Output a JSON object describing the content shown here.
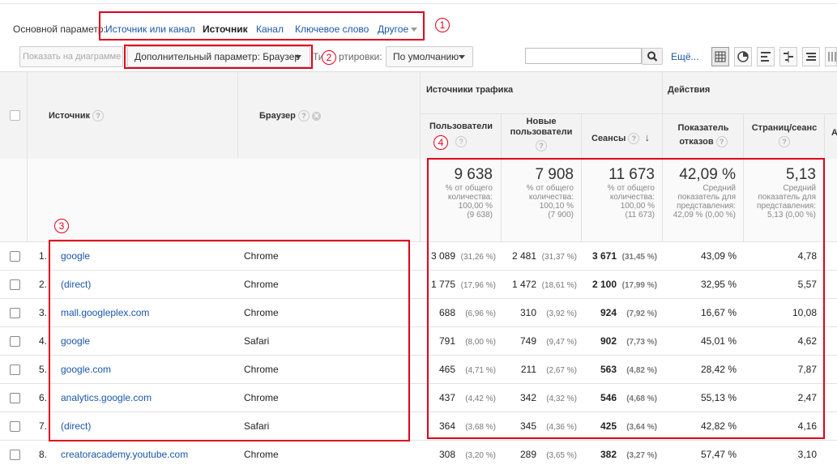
{
  "primary_dim": {
    "label": "Основной параметр:",
    "items": [
      "Источник или канал",
      "Источник",
      "Канал",
      "Ключевое слово",
      "Другое"
    ],
    "active_index": 1
  },
  "toolbar": {
    "plot_rows": "Показать на диаграмме",
    "secondary_dim": "Дополнительный параметр: Браузер",
    "sort_label_visible": "Ти",
    "sort_label_tail": "ртировки:",
    "sort_value": "По умолчанию",
    "search_placeholder": "",
    "more_link": "Ещё..."
  },
  "badges": [
    "1",
    "2",
    "3",
    "4"
  ],
  "columns": {
    "source": "Источник",
    "browser": "Браузер",
    "group_traffic": "Источники трафика",
    "group_actions": "Действия",
    "users": "Пользователи",
    "new_users_1": "Новые",
    "new_users_2": "пользователи",
    "sessions": "Сеансы",
    "bounce_1": "Показатель",
    "bounce_2": "отказов",
    "pages": "Страниц/сеанс",
    "next_partial": "А"
  },
  "totals": {
    "users": {
      "big": "9 638",
      "l1": "% от общего",
      "l2": "количества:",
      "l3": "100,00 %",
      "l4": "(9 638)"
    },
    "new_users": {
      "big": "7 908",
      "l1": "% от общего",
      "l2": "количества:",
      "l3": "100,10 %",
      "l4": "(7 900)"
    },
    "sessions": {
      "big": "11 673",
      "l1": "% от общего",
      "l2": "количества:",
      "l3": "100,00 %",
      "l4": "(11 673)"
    },
    "bounce": {
      "big": "42,09 %",
      "l1": "Средний",
      "l2": "показатель для",
      "l3": "представления:",
      "l4": "42,09 % (0,00 %)"
    },
    "pages": {
      "big": "5,13",
      "l1": "Средний",
      "l2": "показатель для",
      "l3": "представления:",
      "l4": "5,13 (0,00 %)"
    }
  },
  "rows": [
    {
      "idx": "1.",
      "source": "google",
      "browser": "Chrome",
      "users": "3 089",
      "users_pct": "(31,26 %)",
      "new": "2 481",
      "new_pct": "(31,37 %)",
      "sess": "3 671",
      "sess_pct": "(31,45 %)",
      "bounce": "43,09 %",
      "pages": "4,78"
    },
    {
      "idx": "2.",
      "source": "(direct)",
      "browser": "Chrome",
      "users": "1 775",
      "users_pct": "(17,96 %)",
      "new": "1 472",
      "new_pct": "(18,61 %)",
      "sess": "2 100",
      "sess_pct": "(17,99 %)",
      "bounce": "32,95 %",
      "pages": "5,57"
    },
    {
      "idx": "3.",
      "source": "mall.googleplex.com",
      "browser": "Chrome",
      "users": "688",
      "users_pct": "(6,96 %)",
      "new": "310",
      "new_pct": "(3,92 %)",
      "sess": "924",
      "sess_pct": "(7,92 %)",
      "bounce": "16,67 %",
      "pages": "10,08"
    },
    {
      "idx": "4.",
      "source": "google",
      "browser": "Safari",
      "users": "791",
      "users_pct": "(8,00 %)",
      "new": "749",
      "new_pct": "(9,47 %)",
      "sess": "902",
      "sess_pct": "(7,73 %)",
      "bounce": "45,01 %",
      "pages": "4,62"
    },
    {
      "idx": "5.",
      "source": "google.com",
      "browser": "Chrome",
      "users": "465",
      "users_pct": "(4,71 %)",
      "new": "211",
      "new_pct": "(2,67 %)",
      "sess": "563",
      "sess_pct": "(4,82 %)",
      "bounce": "28,42 %",
      "pages": "7,87"
    },
    {
      "idx": "6.",
      "source": "analytics.google.com",
      "browser": "Chrome",
      "users": "437",
      "users_pct": "(4,42 %)",
      "new": "342",
      "new_pct": "(4,32 %)",
      "sess": "546",
      "sess_pct": "(4,68 %)",
      "bounce": "55,13 %",
      "pages": "2,47"
    },
    {
      "idx": "7.",
      "source": "(direct)",
      "browser": "Safari",
      "users": "364",
      "users_pct": "(3,68 %)",
      "new": "345",
      "new_pct": "(4,36 %)",
      "sess": "425",
      "sess_pct": "(3,64 %)",
      "bounce": "42,82 %",
      "pages": "4,16"
    },
    {
      "idx": "8.",
      "source": "creatoracademy.youtube.com",
      "browser": "Chrome",
      "users": "308",
      "users_pct": "(3,20 %)",
      "new": "289",
      "new_pct": "(3,65 %)",
      "sess": "382",
      "sess_pct": "(3,27 %)",
      "bounce": "57,47 %",
      "pages": "3,10"
    }
  ],
  "colors": {
    "accent": "#1a56a8",
    "highlight": "#e0001b"
  }
}
